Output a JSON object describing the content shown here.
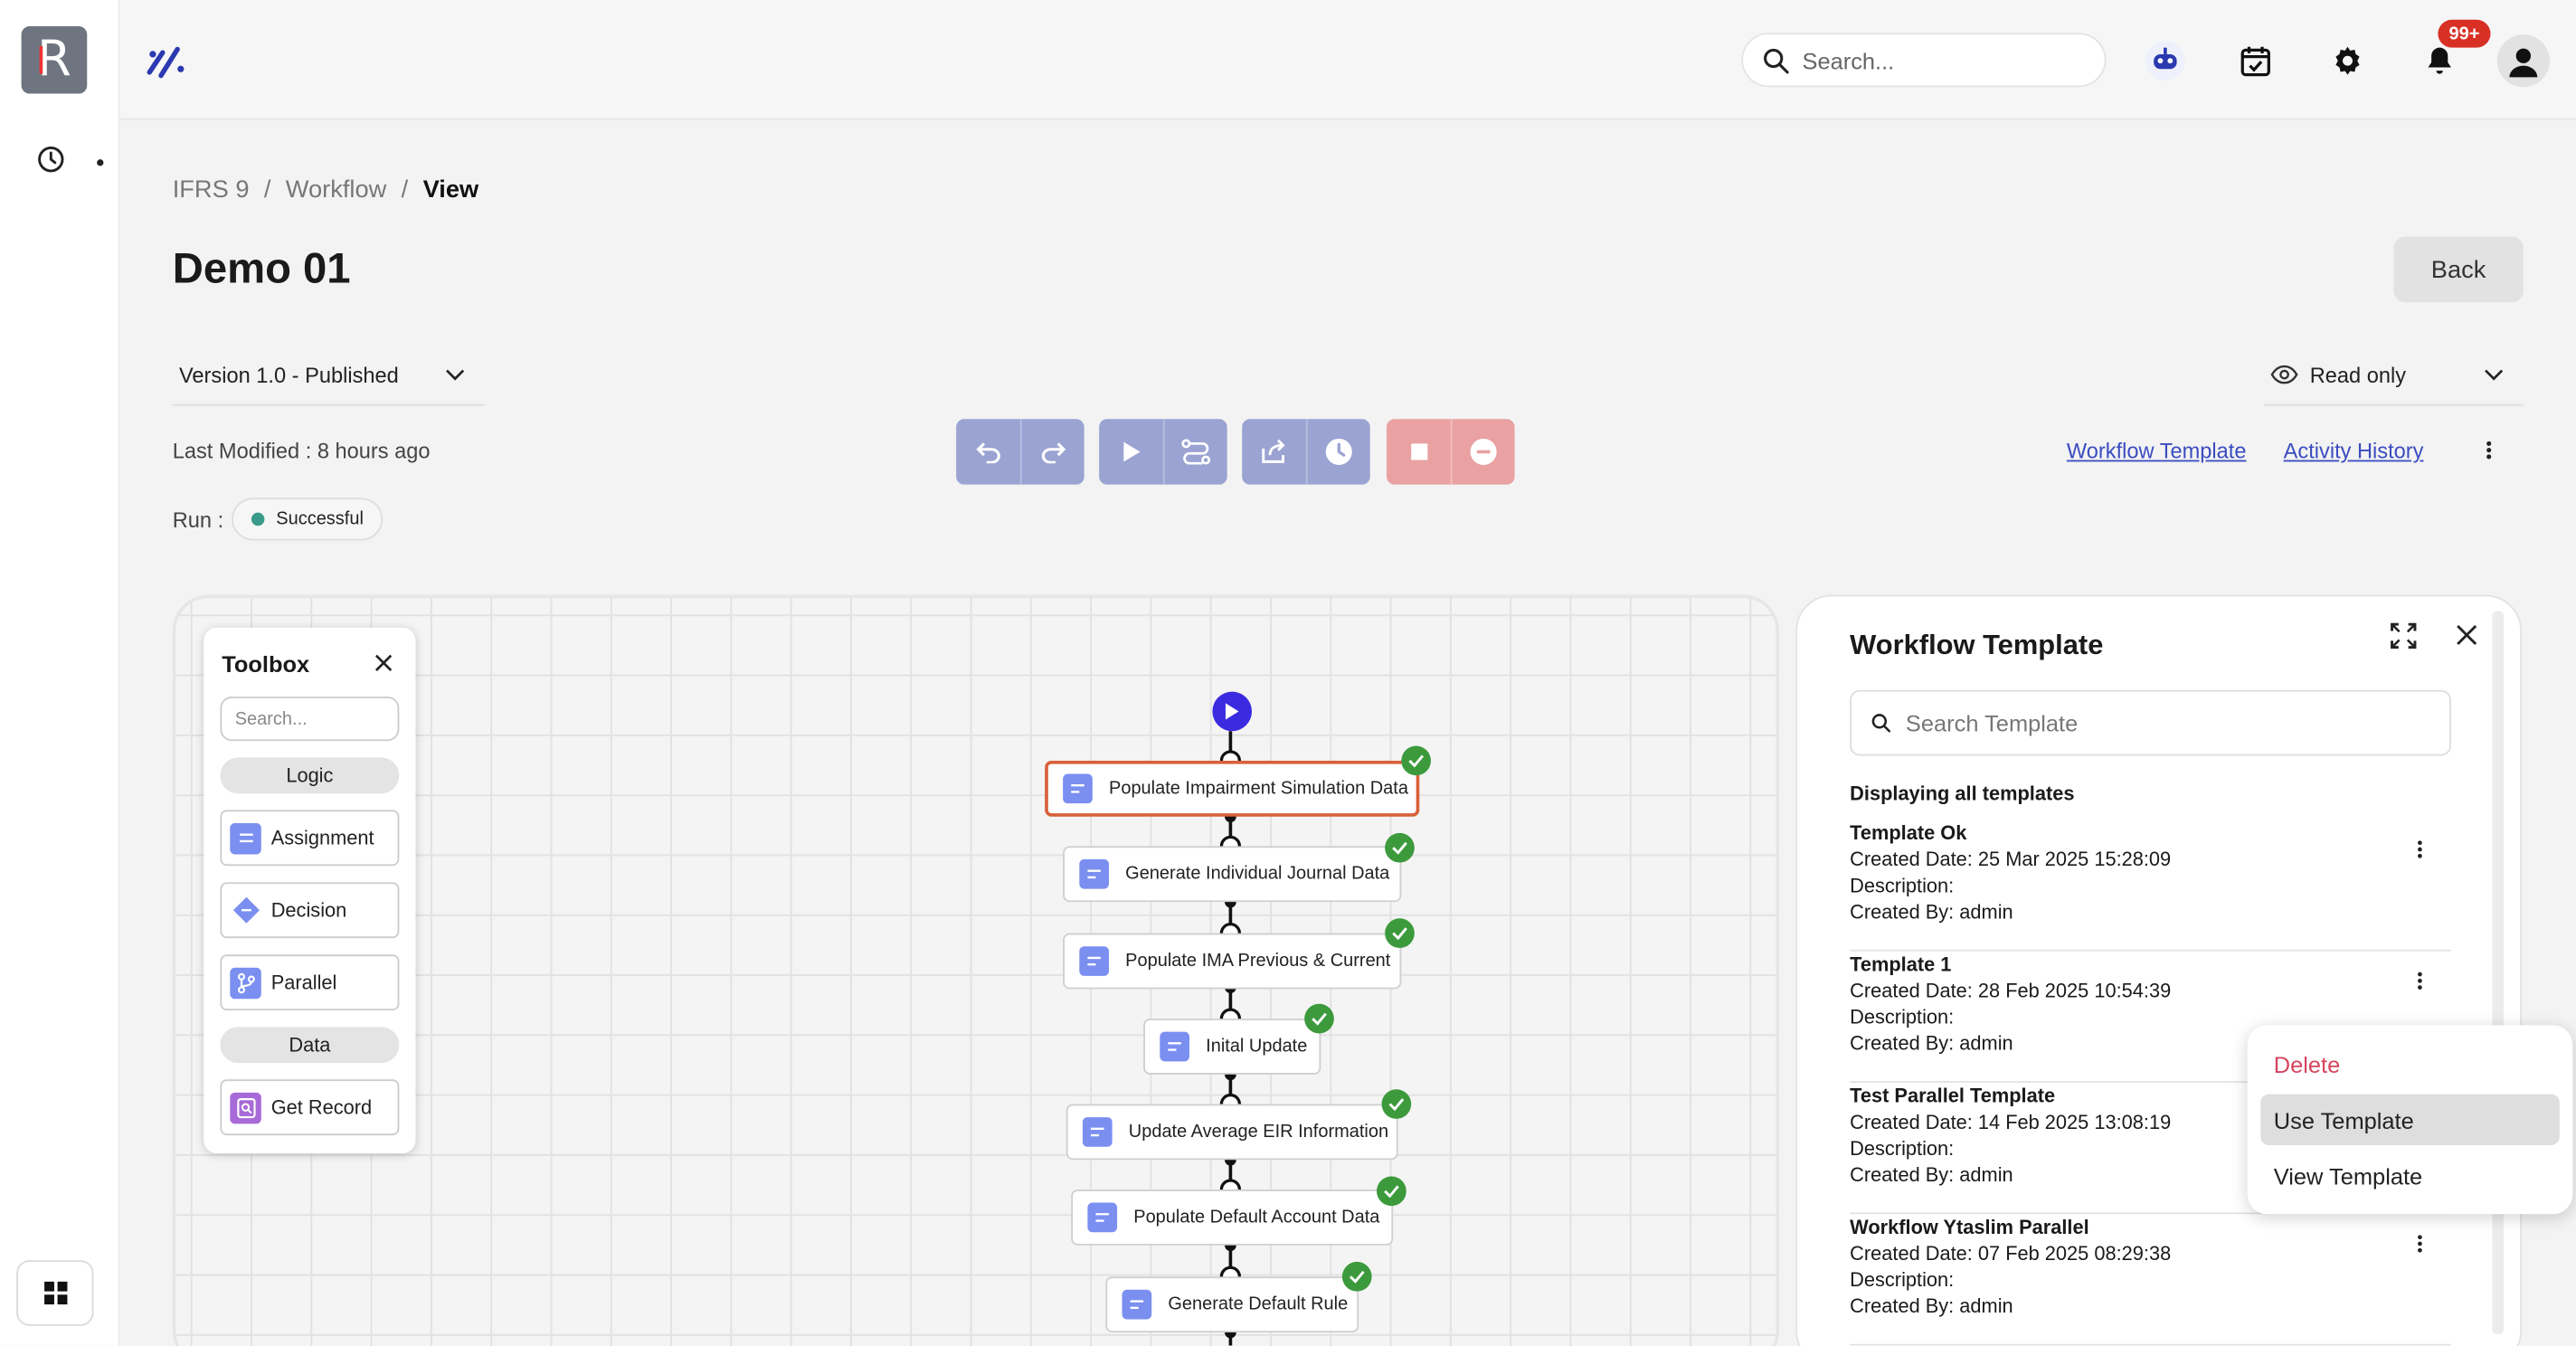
{
  "app": {
    "logo_letter": "R"
  },
  "topbar": {
    "search_placeholder": "Search...",
    "notification_count": "99+",
    "icons": [
      "bot-icon",
      "calendar-check-icon",
      "gear-icon",
      "bell-icon",
      "user-avatar-icon"
    ]
  },
  "breadcrumb": {
    "items": [
      "IFRS 9",
      "Workflow"
    ],
    "current": "View",
    "separator": "/"
  },
  "page": {
    "title": "Demo 01",
    "back_label": "Back",
    "version": "Version 1.0 - Published",
    "mode": "Read only",
    "last_modified": "Last Modified : 8 hours ago",
    "run_label": "Run :",
    "run_status": "Successful"
  },
  "links": {
    "workflow_template": "Workflow Template",
    "activity_history": "Activity History"
  },
  "toolbox": {
    "title": "Toolbox",
    "search_placeholder": "Search...",
    "sections": [
      {
        "label": "Logic",
        "items": [
          "Assignment",
          "Decision",
          "Parallel"
        ]
      },
      {
        "label": "Data",
        "items": [
          "Get Record"
        ]
      }
    ]
  },
  "flow": {
    "nodes": [
      "Populate Impairment Simulation Data",
      "Generate Individual Journal Data",
      "Populate IMA Previous & Current",
      "Inital Update",
      "Update Average EIR Information",
      "Populate Default Account Data",
      "Generate Default Rule"
    ],
    "selected_index": 0,
    "status": "success"
  },
  "panel": {
    "title": "Workflow Template",
    "search_placeholder": "Search Template",
    "displaying": "Displaying all templates",
    "templates": [
      {
        "name": "Template Ok",
        "created": "Created Date: 25 Mar 2025 15:28:09",
        "description": "Description:",
        "by": "Created By: admin"
      },
      {
        "name": "Template 1",
        "created": "Created Date: 28 Feb 2025 10:54:39",
        "description": "Description:",
        "by": "Created By: admin"
      },
      {
        "name": "Test Parallel Template",
        "created": "Created Date: 14 Feb 2025 13:08:19",
        "description": "Description:",
        "by": "Created By: admin"
      },
      {
        "name": "Workflow Ytaslim Parallel",
        "created": "Created Date: 07 Feb 2025 08:29:38",
        "description": "Description:",
        "by": "Created By: admin"
      }
    ]
  },
  "context_menu": {
    "items": [
      "Delete",
      "Use Template",
      "View Template"
    ],
    "highlighted": "Use Template"
  },
  "colors": {
    "accent": "#3b4cc0",
    "toolbar_blue": "#9aa3d2",
    "toolbar_red": "#e9a1a1",
    "success": "#3c9a3c",
    "selected_border": "#d9603a",
    "danger": "#d6455d"
  }
}
